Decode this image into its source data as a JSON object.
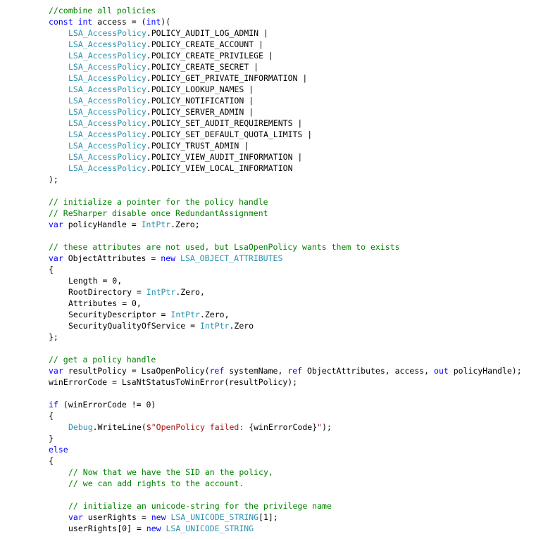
{
  "editor": {
    "lines": [
      {
        "indent": 1,
        "tokens": [
          {
            "k": "com",
            "t": "//combine all policies"
          }
        ]
      },
      {
        "indent": 1,
        "tokens": [
          {
            "k": "kw",
            "t": "const"
          },
          {
            "k": "plain",
            "t": " "
          },
          {
            "k": "kw",
            "t": "int"
          },
          {
            "k": "plain",
            "t": " access = ("
          },
          {
            "k": "kw",
            "t": "int"
          },
          {
            "k": "plain",
            "t": ")("
          }
        ]
      },
      {
        "indent": 2,
        "tokens": [
          {
            "k": "type",
            "t": "LSA_AccessPolicy"
          },
          {
            "k": "plain",
            "t": ".POLICY_AUDIT_LOG_ADMIN |"
          }
        ]
      },
      {
        "indent": 2,
        "tokens": [
          {
            "k": "type",
            "t": "LSA_AccessPolicy"
          },
          {
            "k": "plain",
            "t": ".POLICY_CREATE_ACCOUNT |"
          }
        ]
      },
      {
        "indent": 2,
        "tokens": [
          {
            "k": "type",
            "t": "LSA_AccessPolicy"
          },
          {
            "k": "plain",
            "t": ".POLICY_CREATE_PRIVILEGE |"
          }
        ]
      },
      {
        "indent": 2,
        "tokens": [
          {
            "k": "type",
            "t": "LSA_AccessPolicy"
          },
          {
            "k": "plain",
            "t": ".POLICY_CREATE_SECRET |"
          }
        ]
      },
      {
        "indent": 2,
        "tokens": [
          {
            "k": "type",
            "t": "LSA_AccessPolicy"
          },
          {
            "k": "plain",
            "t": ".POLICY_GET_PRIVATE_INFORMATION |"
          }
        ]
      },
      {
        "indent": 2,
        "tokens": [
          {
            "k": "type",
            "t": "LSA_AccessPolicy"
          },
          {
            "k": "plain",
            "t": ".POLICY_LOOKUP_NAMES |"
          }
        ]
      },
      {
        "indent": 2,
        "tokens": [
          {
            "k": "type",
            "t": "LSA_AccessPolicy"
          },
          {
            "k": "plain",
            "t": ".POLICY_NOTIFICATION |"
          }
        ]
      },
      {
        "indent": 2,
        "tokens": [
          {
            "k": "type",
            "t": "LSA_AccessPolicy"
          },
          {
            "k": "plain",
            "t": ".POLICY_SERVER_ADMIN |"
          }
        ]
      },
      {
        "indent": 2,
        "tokens": [
          {
            "k": "type",
            "t": "LSA_AccessPolicy"
          },
          {
            "k": "plain",
            "t": ".POLICY_SET_AUDIT_REQUIREMENTS |"
          }
        ]
      },
      {
        "indent": 2,
        "tokens": [
          {
            "k": "type",
            "t": "LSA_AccessPolicy"
          },
          {
            "k": "plain",
            "t": ".POLICY_SET_DEFAULT_QUOTA_LIMITS |"
          }
        ]
      },
      {
        "indent": 2,
        "tokens": [
          {
            "k": "type",
            "t": "LSA_AccessPolicy"
          },
          {
            "k": "plain",
            "t": ".POLICY_TRUST_ADMIN |"
          }
        ]
      },
      {
        "indent": 2,
        "tokens": [
          {
            "k": "type",
            "t": "LSA_AccessPolicy"
          },
          {
            "k": "plain",
            "t": ".POLICY_VIEW_AUDIT_INFORMATION |"
          }
        ]
      },
      {
        "indent": 2,
        "tokens": [
          {
            "k": "type",
            "t": "LSA_AccessPolicy"
          },
          {
            "k": "plain",
            "t": ".POLICY_VIEW_LOCAL_INFORMATION"
          }
        ]
      },
      {
        "indent": 1,
        "tokens": [
          {
            "k": "plain",
            "t": ");"
          }
        ]
      },
      {
        "indent": 1,
        "tokens": []
      },
      {
        "indent": 1,
        "tokens": [
          {
            "k": "com",
            "t": "// initialize a pointer for the policy handle"
          }
        ]
      },
      {
        "indent": 1,
        "tokens": [
          {
            "k": "com",
            "t": "// ReSharper disable once RedundantAssignment"
          }
        ]
      },
      {
        "indent": 1,
        "tokens": [
          {
            "k": "kw",
            "t": "var"
          },
          {
            "k": "plain",
            "t": " policyHandle = "
          },
          {
            "k": "type",
            "t": "IntPtr"
          },
          {
            "k": "plain",
            "t": ".Zero;"
          }
        ]
      },
      {
        "indent": 1,
        "tokens": []
      },
      {
        "indent": 1,
        "tokens": [
          {
            "k": "com",
            "t": "// these attributes are not used, but LsaOpenPolicy wants them to exists"
          }
        ]
      },
      {
        "indent": 1,
        "tokens": [
          {
            "k": "kw",
            "t": "var"
          },
          {
            "k": "plain",
            "t": " ObjectAttributes = "
          },
          {
            "k": "kw",
            "t": "new"
          },
          {
            "k": "plain",
            "t": " "
          },
          {
            "k": "type",
            "t": "LSA_OBJECT_ATTRIBUTES"
          }
        ]
      },
      {
        "indent": 1,
        "tokens": [
          {
            "k": "plain",
            "t": "{"
          }
        ]
      },
      {
        "indent": 2,
        "tokens": [
          {
            "k": "plain",
            "t": "Length = 0,"
          }
        ]
      },
      {
        "indent": 2,
        "tokens": [
          {
            "k": "plain",
            "t": "RootDirectory = "
          },
          {
            "k": "type",
            "t": "IntPtr"
          },
          {
            "k": "plain",
            "t": ".Zero,"
          }
        ]
      },
      {
        "indent": 2,
        "tokens": [
          {
            "k": "plain",
            "t": "Attributes = 0,"
          }
        ]
      },
      {
        "indent": 2,
        "tokens": [
          {
            "k": "plain",
            "t": "SecurityDescriptor = "
          },
          {
            "k": "type",
            "t": "IntPtr"
          },
          {
            "k": "plain",
            "t": ".Zero,"
          }
        ]
      },
      {
        "indent": 2,
        "tokens": [
          {
            "k": "plain",
            "t": "SecurityQualityOfService = "
          },
          {
            "k": "type",
            "t": "IntPtr"
          },
          {
            "k": "plain",
            "t": ".Zero"
          }
        ]
      },
      {
        "indent": 1,
        "tokens": [
          {
            "k": "plain",
            "t": "};"
          }
        ]
      },
      {
        "indent": 1,
        "tokens": []
      },
      {
        "indent": 1,
        "tokens": [
          {
            "k": "com",
            "t": "// get a policy handle"
          }
        ]
      },
      {
        "indent": 1,
        "tokens": [
          {
            "k": "kw",
            "t": "var"
          },
          {
            "k": "plain",
            "t": " resultPolicy = LsaOpenPolicy("
          },
          {
            "k": "kw",
            "t": "ref"
          },
          {
            "k": "plain",
            "t": " systemName, "
          },
          {
            "k": "kw",
            "t": "ref"
          },
          {
            "k": "plain",
            "t": " ObjectAttributes, access, "
          },
          {
            "k": "kw",
            "t": "out"
          },
          {
            "k": "plain",
            "t": " policyHandle);"
          }
        ]
      },
      {
        "indent": 1,
        "tokens": [
          {
            "k": "plain",
            "t": "winErrorCode = LsaNtStatusToWinError(resultPolicy);"
          }
        ]
      },
      {
        "indent": 1,
        "tokens": []
      },
      {
        "indent": 1,
        "tokens": [
          {
            "k": "kw",
            "t": "if"
          },
          {
            "k": "plain",
            "t": " (winErrorCode != 0)"
          }
        ]
      },
      {
        "indent": 1,
        "tokens": [
          {
            "k": "plain",
            "t": "{"
          }
        ]
      },
      {
        "indent": 2,
        "tokens": [
          {
            "k": "type",
            "t": "Debug"
          },
          {
            "k": "plain",
            "t": ".WriteLine("
          },
          {
            "k": "str",
            "t": "$\"OpenPolicy failed: "
          },
          {
            "k": "plain",
            "t": "{winErrorCode}"
          },
          {
            "k": "str",
            "t": "\""
          },
          {
            "k": "plain",
            "t": ");"
          }
        ]
      },
      {
        "indent": 1,
        "tokens": [
          {
            "k": "plain",
            "t": "}"
          }
        ]
      },
      {
        "indent": 1,
        "tokens": [
          {
            "k": "kw",
            "t": "else"
          }
        ]
      },
      {
        "indent": 1,
        "tokens": [
          {
            "k": "plain",
            "t": "{"
          }
        ]
      },
      {
        "indent": 2,
        "tokens": [
          {
            "k": "com",
            "t": "// Now that we have the SID an the policy,"
          }
        ]
      },
      {
        "indent": 2,
        "tokens": [
          {
            "k": "com",
            "t": "// we can add rights to the account."
          }
        ]
      },
      {
        "indent": 2,
        "tokens": []
      },
      {
        "indent": 2,
        "tokens": [
          {
            "k": "com",
            "t": "// initialize an unicode-string for the privilege name"
          }
        ]
      },
      {
        "indent": 2,
        "tokens": [
          {
            "k": "kw",
            "t": "var"
          },
          {
            "k": "plain",
            "t": " userRights = "
          },
          {
            "k": "kw",
            "t": "new"
          },
          {
            "k": "plain",
            "t": " "
          },
          {
            "k": "type",
            "t": "LSA_UNICODE_STRING"
          },
          {
            "k": "plain",
            "t": "[1];"
          }
        ]
      },
      {
        "indent": 2,
        "tokens": [
          {
            "k": "plain",
            "t": "userRights[0] = "
          },
          {
            "k": "kw",
            "t": "new"
          },
          {
            "k": "plain",
            "t": " "
          },
          {
            "k": "type",
            "t": "LSA_UNICODE_STRING"
          }
        ]
      }
    ]
  }
}
